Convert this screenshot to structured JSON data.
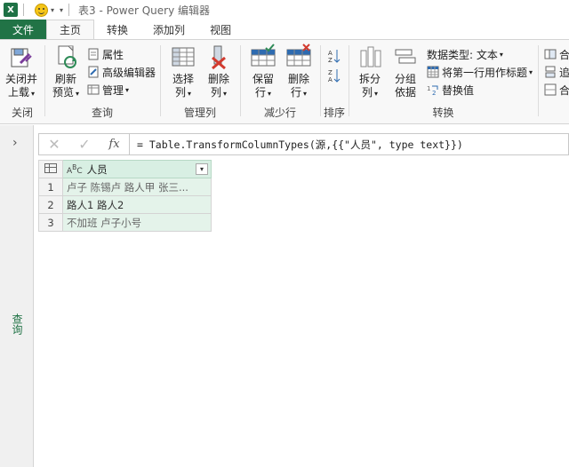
{
  "titlebar": {
    "app_icon": "X",
    "title": "表3 - Power Query 编辑器"
  },
  "tabs": [
    {
      "label": "文件"
    },
    {
      "label": "主页"
    },
    {
      "label": "转换"
    },
    {
      "label": "添加列"
    },
    {
      "label": "视图"
    }
  ],
  "ribbon": {
    "groups": [
      {
        "label": "关闭"
      },
      {
        "label": "查询"
      },
      {
        "label": "管理列"
      },
      {
        "label": "减少行"
      },
      {
        "label": "排序"
      },
      {
        "label": "转换"
      }
    ],
    "close_load": [
      "关闭并",
      "上载"
    ],
    "refresh_preview": [
      "刷新",
      "预览"
    ],
    "properties": "属性",
    "advanced_editor": "高级编辑器",
    "manage": "管理",
    "choose_columns": [
      "选择",
      "列"
    ],
    "remove_columns": [
      "删除",
      "列"
    ],
    "keep_rows": [
      "保留",
      "行"
    ],
    "remove_rows": [
      "删除",
      "行"
    ],
    "split_column": [
      "拆分",
      "列"
    ],
    "group_by": [
      "分组",
      "依据"
    ],
    "data_type": "数据类型: 文本",
    "first_row_headers": "将第一行用作标题",
    "replace_values": "替换值",
    "right_partial": [
      "合",
      "追",
      "合"
    ]
  },
  "left_pane": {
    "label": "查询"
  },
  "formula": {
    "text": "= Table.TransformColumnTypes(源,{{\"人员\", type text}})"
  },
  "table": {
    "column": "人员",
    "rows": [
      {
        "num": "1",
        "value": "卢子 陈锡卢 路人甲 张三..."
      },
      {
        "num": "2",
        "value": "路人1 路人2"
      },
      {
        "num": "3",
        "value": "不加班 卢子小号"
      }
    ]
  },
  "colors": {
    "file_tab": "#217346",
    "column_bg": "#e4f3ea"
  }
}
